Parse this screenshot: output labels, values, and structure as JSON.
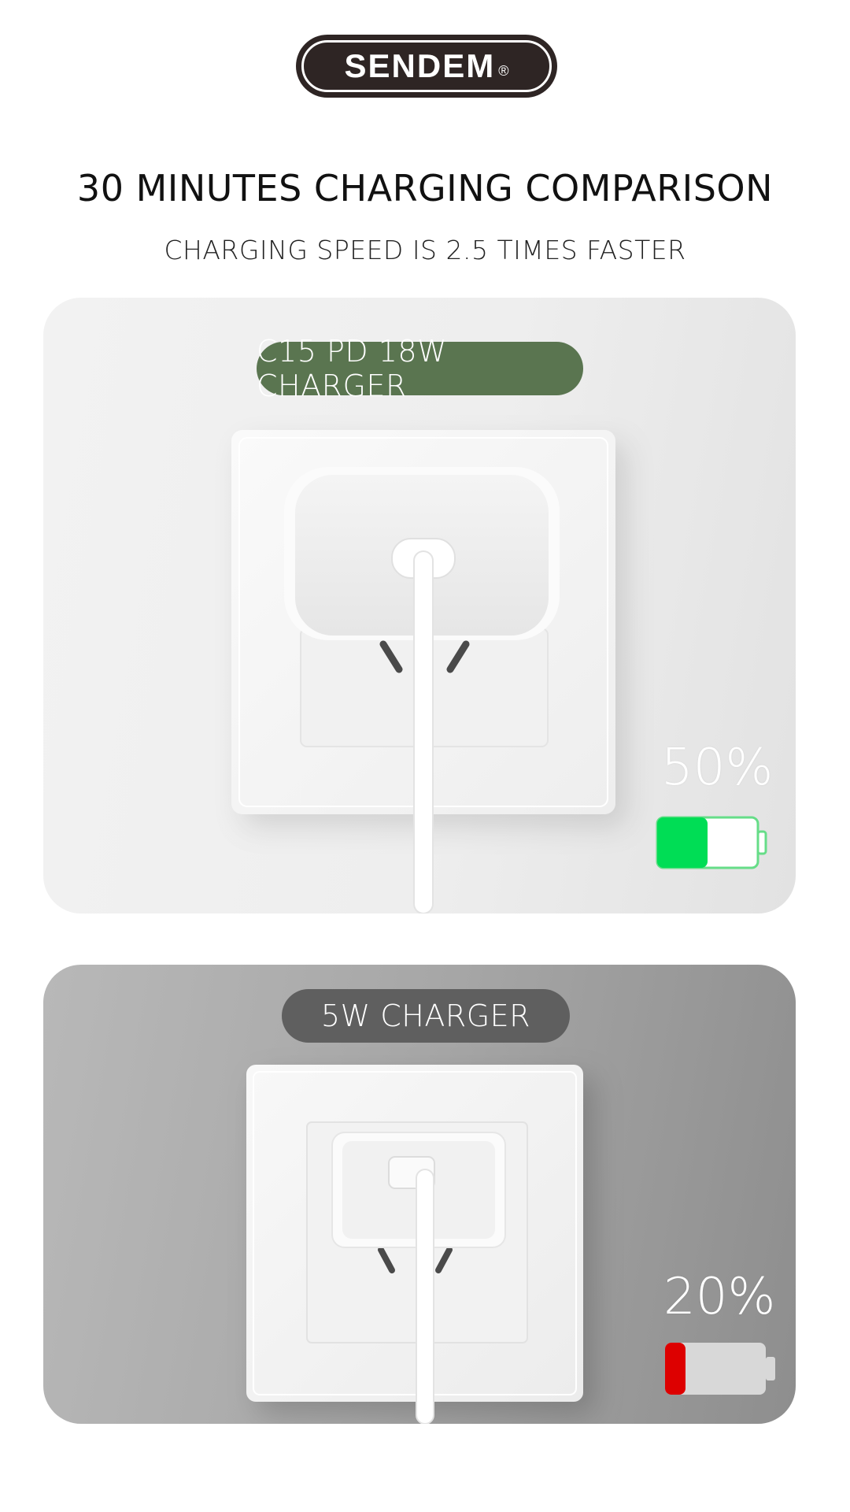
{
  "brand": {
    "logo_text": "SENDEM",
    "registered_mark": "®"
  },
  "header": {
    "title": "30 MINUTES CHARGING COMPARISON",
    "subtitle": "CHARGING SPEED IS 2.5 TIMES FASTER"
  },
  "comparisons": [
    {
      "label": "C15 PD 18W CHARGER",
      "percent_text": "50%",
      "charge_level": 0.5,
      "fill_color": "#00dd55",
      "label_bg": "#5a7550"
    },
    {
      "label": "5W CHARGER",
      "percent_text": "20%",
      "charge_level": 0.2,
      "fill_color": "#dd0000",
      "label_bg": "#5f5f5f"
    }
  ],
  "colors": {
    "top_panel": "#eeeeee",
    "bottom_panel": "#a6a6a6",
    "plate": "#f7f7f7"
  }
}
